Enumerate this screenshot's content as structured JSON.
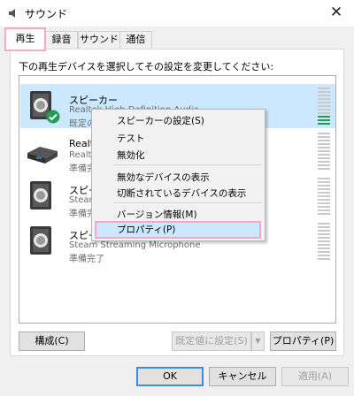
{
  "window": {
    "title": "サウンド",
    "close_glyph": "✕"
  },
  "tabs": [
    {
      "label": "再生",
      "active": true
    },
    {
      "label": "録音"
    },
    {
      "label": "サウンド"
    },
    {
      "label": "通信"
    }
  ],
  "instruction": "下の再生デバイスを選択してその設定を変更してください:",
  "devices": [
    {
      "name": "スピーカー",
      "description": "Realtek High Definition Audio",
      "status": "既定のデバイス",
      "selected": true,
      "default": true
    },
    {
      "name": "Realtek Digital Output",
      "description": "Realtek High Definition Audio",
      "status": "準備完了"
    },
    {
      "name": "スピーカー",
      "description": "Steam Streaming Speakers",
      "status": "準備完了"
    },
    {
      "name": "スピーカー",
      "description": "Steam Streaming Microphone",
      "status": "準備完了"
    }
  ],
  "context_menu": {
    "items": [
      "スピーカーの設定(S)",
      "テスト",
      "無効化",
      "無効なデバイスの表示",
      "切断されているデバイスの表示",
      "バージョン情報(M)",
      "プロパティ(P)"
    ],
    "highlighted": "プロパティ(P)"
  },
  "buttons": {
    "configure": "構成(C)",
    "set_default": "既定値に設定(S)",
    "properties": "プロパティ(P)",
    "ok": "OK",
    "cancel": "キャンセル",
    "apply": "適用(A)"
  },
  "colors": {
    "selection": "#cce8ff",
    "highlight_border": "#f3a9c9",
    "check_green": "#1f9d55"
  }
}
